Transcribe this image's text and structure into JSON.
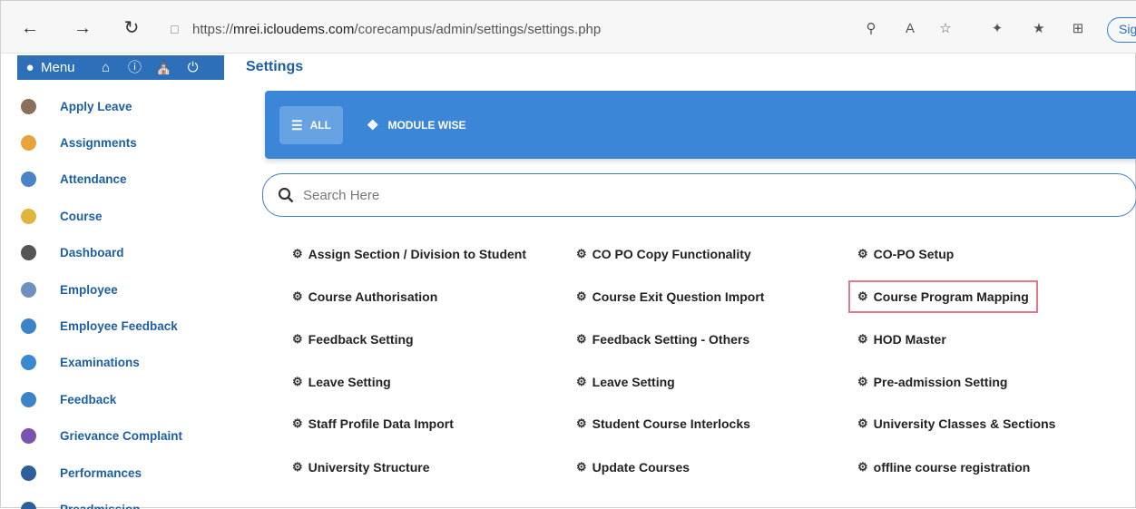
{
  "browser": {
    "url_prefix": "https://",
    "url_host": "mrei.icloudems.com",
    "url_path": "/corecampus/admin/settings/settings.php",
    "signin_label": "Sign"
  },
  "header": {
    "menu_label": "Menu",
    "page_title": "Settings"
  },
  "sidebar": {
    "items": [
      {
        "label": "Apply Leave",
        "color": "#8a6f5a"
      },
      {
        "label": "Assignments",
        "color": "#e8a33c"
      },
      {
        "label": "Attendance",
        "color": "#4a83c6"
      },
      {
        "label": "Course",
        "color": "#e1b43e"
      },
      {
        "label": "Dashboard",
        "color": "#555555"
      },
      {
        "label": "Employee",
        "color": "#6f90c0"
      },
      {
        "label": "Employee Feedback",
        "color": "#3e83c8"
      },
      {
        "label": "Examinations",
        "color": "#3a89cf"
      },
      {
        "label": "Feedback",
        "color": "#3e83c8"
      },
      {
        "label": "Grievance Complaint",
        "color": "#7a52b0"
      },
      {
        "label": "Performances",
        "color": "#2e5f9c"
      },
      {
        "label": "Preadmission",
        "color": "#2e5f9c"
      }
    ]
  },
  "tabs": {
    "all_label": "ALL",
    "module_label": "MODULE WISE"
  },
  "search": {
    "placeholder": "Search Here"
  },
  "settings": {
    "col1": [
      "Assign Section / Division to Student",
      "Course Authorisation",
      "Feedback Setting",
      "Leave Setting",
      "Staff Profile Data Import",
      "University Structure"
    ],
    "col2": [
      "CO PO Copy Functionality",
      "Course Exit Question Import",
      "Feedback Setting - Others",
      "Leave Setting",
      "Student Course Interlocks",
      "Update Courses"
    ],
    "col3": [
      "CO-PO Setup",
      "Course Program Mapping",
      "HOD Master",
      "Pre-admission Setting",
      "University Classes & Sections",
      "offline course registration"
    ]
  }
}
